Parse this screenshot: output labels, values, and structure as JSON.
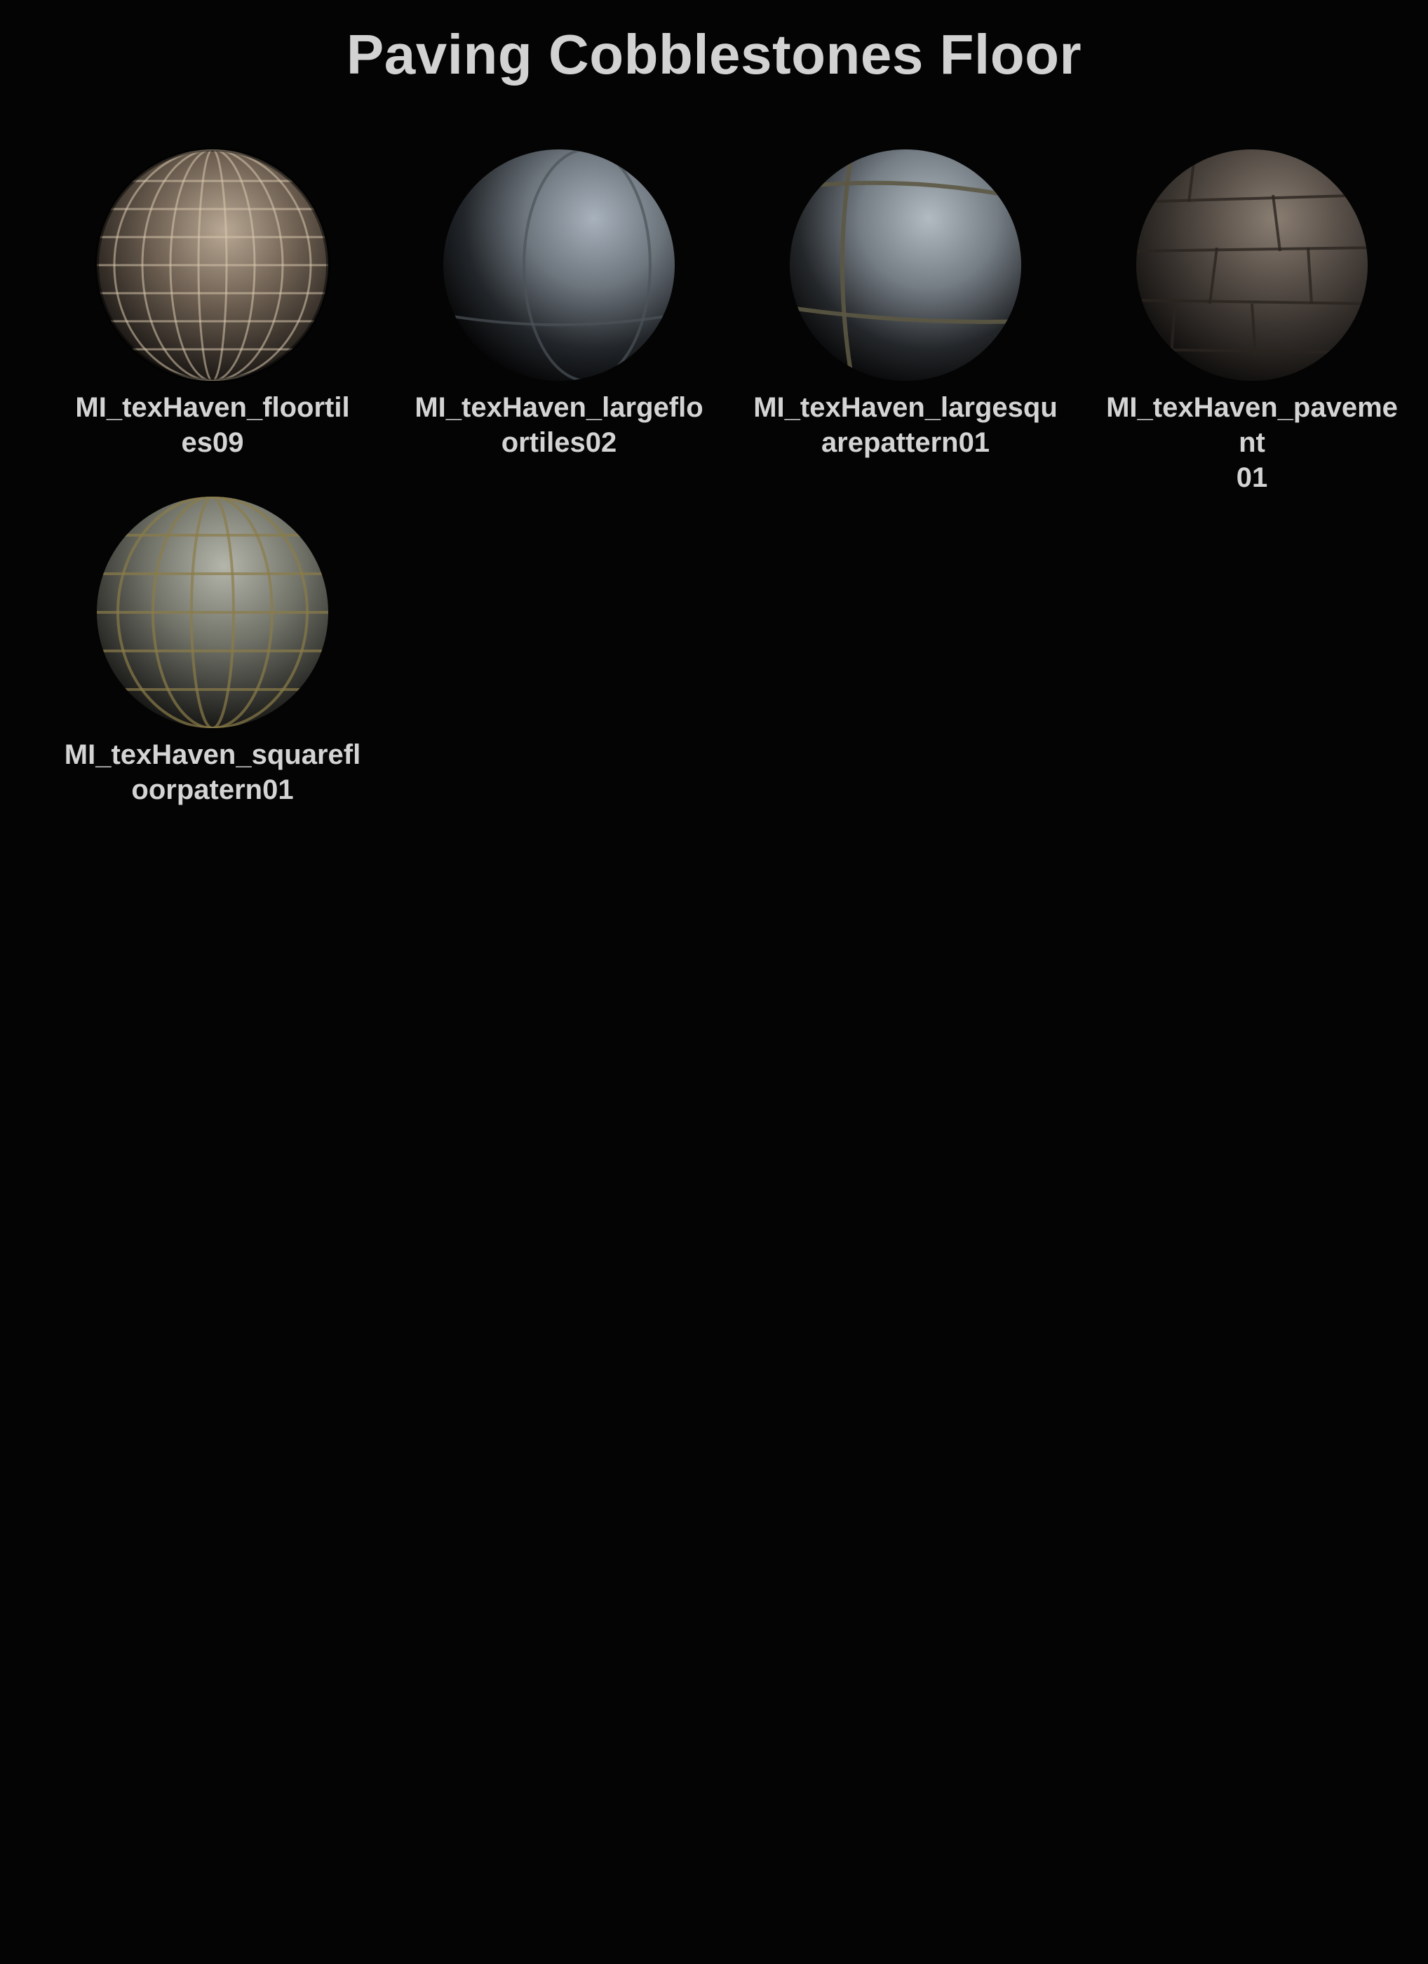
{
  "page": {
    "title": "Paving Cobblestones Floor"
  },
  "materials": [
    {
      "label_line1": "MI_texHaven_floortil",
      "label_line2": "es09",
      "icon": "material-sphere-icon",
      "color_light": "#9a8a78",
      "color_dark": "#2a2420",
      "grout": "#c8b69c"
    },
    {
      "label_line1": "MI_texHaven_largeflo",
      "label_line2": "ortiles02",
      "icon": "material-sphere-icon",
      "color_light": "#9aa6b0",
      "color_dark": "#16181b",
      "grout": "#5f656b"
    },
    {
      "label_line1": "MI_texHaven_largesqu",
      "label_line2": "arepattern01",
      "icon": "material-sphere-icon",
      "color_light": "#a2aab2",
      "color_dark": "#17191b",
      "grout": "#5c5844"
    },
    {
      "label_line1": "MI_texHaven_pavement",
      "label_line2": "01",
      "icon": "material-sphere-icon",
      "color_light": "#7c7064",
      "color_dark": "#1c1917",
      "grout": "#4a4036"
    },
    {
      "label_line1": "MI_texHaven_squarefl",
      "label_line2": "oorpatern01",
      "icon": "material-sphere-icon",
      "color_light": "#a3a59c",
      "color_dark": "#1a1a17",
      "grout": "#7a6f45"
    }
  ]
}
